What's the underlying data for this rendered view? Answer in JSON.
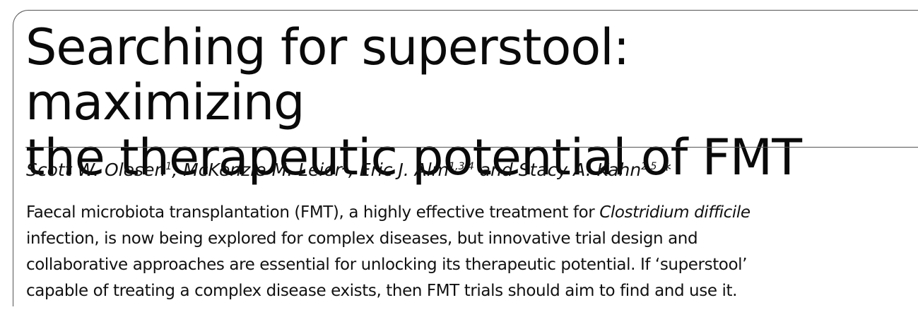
{
  "title": {
    "line1": "Searching for superstool: maximizing",
    "line2": "the therapeutic potential of FMT"
  },
  "authors": [
    {
      "name": "Scott W. Olesen",
      "affil": "1",
      "sep": ", "
    },
    {
      "name": "McKenzie M. Leier",
      "affil": "2",
      "sep": ", "
    },
    {
      "name": "Eric J. Alm",
      "affil": "1,3,4",
      "sep": " and "
    },
    {
      "name": "Stacy A. Kahn",
      "affil": "2,5",
      "sep": ""
    }
  ],
  "corresponding_mark": " *",
  "abstract": {
    "l1_pre": "Faecal microbiota transplantation (FMT), a highly effective treatment for ",
    "l1_italic": "Clostridium difficile",
    "l2": "infection, is now being explored for complex diseases, but innovative trial design and",
    "l3": "collaborative approaches are essential for unlocking its therapeutic potential. If ‘superstool’",
    "l4": "capable of treating a complex disease exists, then FMT trials should aim to find and use it."
  }
}
